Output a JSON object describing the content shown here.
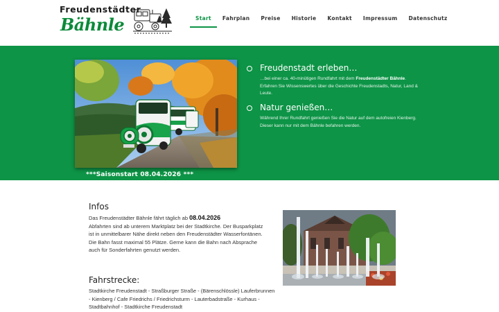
{
  "logo": {
    "line1": "Freudenstädter",
    "line2": "Bähnle",
    "icon": "train-logo-icon"
  },
  "nav": {
    "items": [
      {
        "label": "Start",
        "active": true
      },
      {
        "label": "Fahrplan",
        "active": false
      },
      {
        "label": "Preise",
        "active": false
      },
      {
        "label": "Historie",
        "active": false
      },
      {
        "label": "Kontakt",
        "active": false
      },
      {
        "label": "Impressum",
        "active": false
      },
      {
        "label": "Datenschutz",
        "active": false
      }
    ]
  },
  "hero": {
    "image": "autumn-train-photo",
    "saison": "***Saisonstart 08.04.2026 ***"
  },
  "features": [
    {
      "title": "Freudenstadt erleben…",
      "text_pre": "…bei einer ca. 40-minütigen Rundfahrt mit dem ",
      "text_bold": "Freudenstädter Bähnle",
      "text_post": ". Erfahren Sie Wissenswertes über die Geschichte Freudenstadts, Natur, Land & Leute."
    },
    {
      "title": "Natur genießen…",
      "text_pre": "Während Ihrer Rundfahrt genießen Sie die Natur auf dem autofreien Kienberg. Dieser kann nur mit dem Bähnle befahren werden.",
      "text_bold": "",
      "text_post": ""
    }
  ],
  "infos": {
    "title": "Infos",
    "line1_pre": "Das Freudenstädter Bähnle fährt täglich ab ",
    "line1_date": "08.04.2026",
    "rest": "Abfahrten sind ab unterem Marktplatz bei der Stadtkirche. Der Busparkplatz ist in unmittelbarer Nähe direkt neben den Freudenstädter Wasserfontänen. Die Bahn fasst maximal 55 Plätze. Gerne kann die Bahn nach Absprache auch für Sonderfahrten genutzt werden."
  },
  "fahrstrecke": {
    "title": "Fahrstrecke:",
    "text": "Stadtkirche Freudenstadt - Straßburger Straße - (Bärenschlössle) Lauferbrunnen - Kienberg / Cafe Friedrichs / Friedrichsturm - Lauterbadstraße - Kurhaus - Stadtbahnhof - Stadtkirche Freudenstadt"
  },
  "fountain": {
    "image": "fountain-church-photo"
  },
  "colors": {
    "green": "#0d9446",
    "nav_active": "#0b9444",
    "logo_green": "#0b8a3a"
  }
}
